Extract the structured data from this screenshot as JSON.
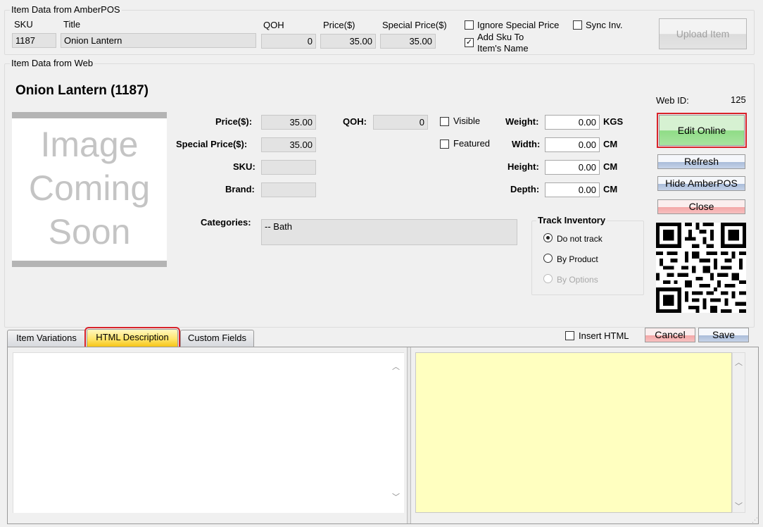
{
  "amber": {
    "group_title": "Item Data from AmberPOS",
    "sku_label": "SKU",
    "title_label": "Title",
    "qoh_label": "QOH",
    "price_label": "Price($)",
    "special_price_label": "Special Price($)",
    "sku": "1187",
    "title": "Onion Lantern",
    "qoh": "0",
    "price": "35.00",
    "special_price": "35.00",
    "ignore_special_label": "Ignore Special Price",
    "ignore_special_checked": false,
    "sync_inv_label": "Sync Inv.",
    "sync_inv_checked": false,
    "add_sku_label_line1": "Add Sku To",
    "add_sku_label_line2": "Item's Name",
    "add_sku_checked": true,
    "upload_label": "Upload Item"
  },
  "web": {
    "group_title": "Item Data from Web",
    "heading": "Onion Lantern (1187)",
    "web_id_label": "Web ID:",
    "web_id": "125",
    "image_placeholder_lines": [
      "Image",
      "Coming",
      "Soon"
    ],
    "price_label": "Price($):",
    "price": "35.00",
    "special_price_label": "Special Price($):",
    "special_price": "35.00",
    "sku_label": "SKU:",
    "sku": "",
    "brand_label": "Brand:",
    "brand": "",
    "qoh_label": "QOH:",
    "qoh": "0",
    "visible_label": "Visible",
    "visible_checked": false,
    "featured_label": "Featured",
    "featured_checked": false,
    "weight_label": "Weight:",
    "weight": "0.00",
    "weight_unit": "KGS",
    "width_label": "Width:",
    "width": "0.00",
    "width_unit": "CM",
    "height_label": "Height:",
    "height": "0.00",
    "height_unit": "CM",
    "depth_label": "Depth:",
    "depth": "0.00",
    "depth_unit": "CM",
    "categories_label": "Categories:",
    "categories_value": "-- Bath",
    "track_inventory_title": "Track Inventory",
    "track_options": [
      {
        "label": "Do not track",
        "selected": true,
        "enabled": true
      },
      {
        "label": "By Product",
        "selected": false,
        "enabled": true
      },
      {
        "label": "By Options",
        "selected": false,
        "enabled": false
      }
    ]
  },
  "buttons": {
    "edit_online": "Edit Online",
    "refresh": "Refresh",
    "hide_amberpos": "Hide AmberPOS",
    "close": "Close",
    "cancel": "Cancel",
    "save": "Save"
  },
  "tabs": [
    {
      "label": "Item Variations",
      "active": false
    },
    {
      "label": "HTML Description",
      "active": true
    },
    {
      "label": "Custom Fields",
      "active": false
    }
  ],
  "insert_html_label": "Insert HTML",
  "insert_html_checked": false,
  "editor": {
    "source_text": "",
    "preview_text": ""
  },
  "colors": {
    "preview_bg": "#ffffc0",
    "highlight": "#d8232a",
    "edit_online_green": "#8fdc86"
  }
}
